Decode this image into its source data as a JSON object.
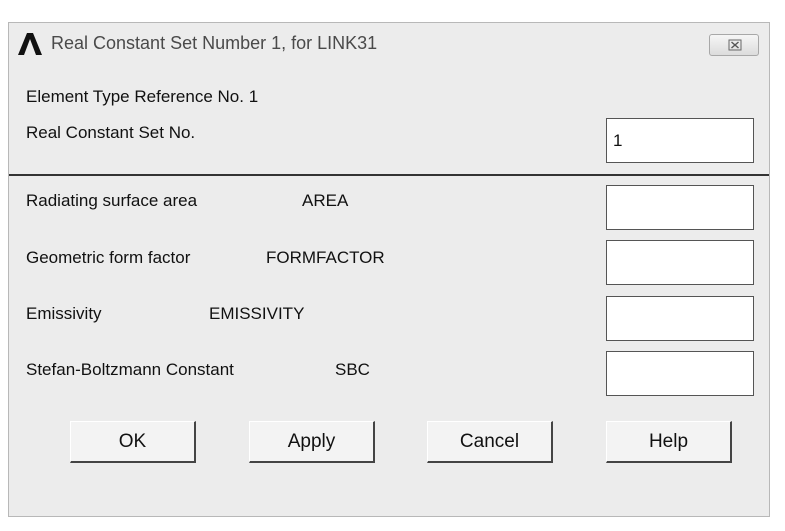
{
  "window": {
    "title": "Real Constant Set Number 1, for LINK31",
    "app_icon": "ansys-logo-icon",
    "close_icon": "close-icon"
  },
  "header": {
    "element_type_reference": "Element Type Reference No. 1",
    "real_constant_set_label": "Real Constant Set No.",
    "real_constant_set_value": "1"
  },
  "constants": [
    {
      "label": "Radiating surface area",
      "keyword": "AREA",
      "value": ""
    },
    {
      "label": "Geometric form factor",
      "keyword": "FORMFACTOR",
      "value": ""
    },
    {
      "label": "Emissivity",
      "keyword": "EMISSIVITY",
      "value": ""
    },
    {
      "label": "Stefan-Boltzmann Constant",
      "keyword": "SBC",
      "value": ""
    }
  ],
  "buttons": {
    "ok": "OK",
    "apply": "Apply",
    "cancel": "Cancel",
    "help": "Help"
  }
}
